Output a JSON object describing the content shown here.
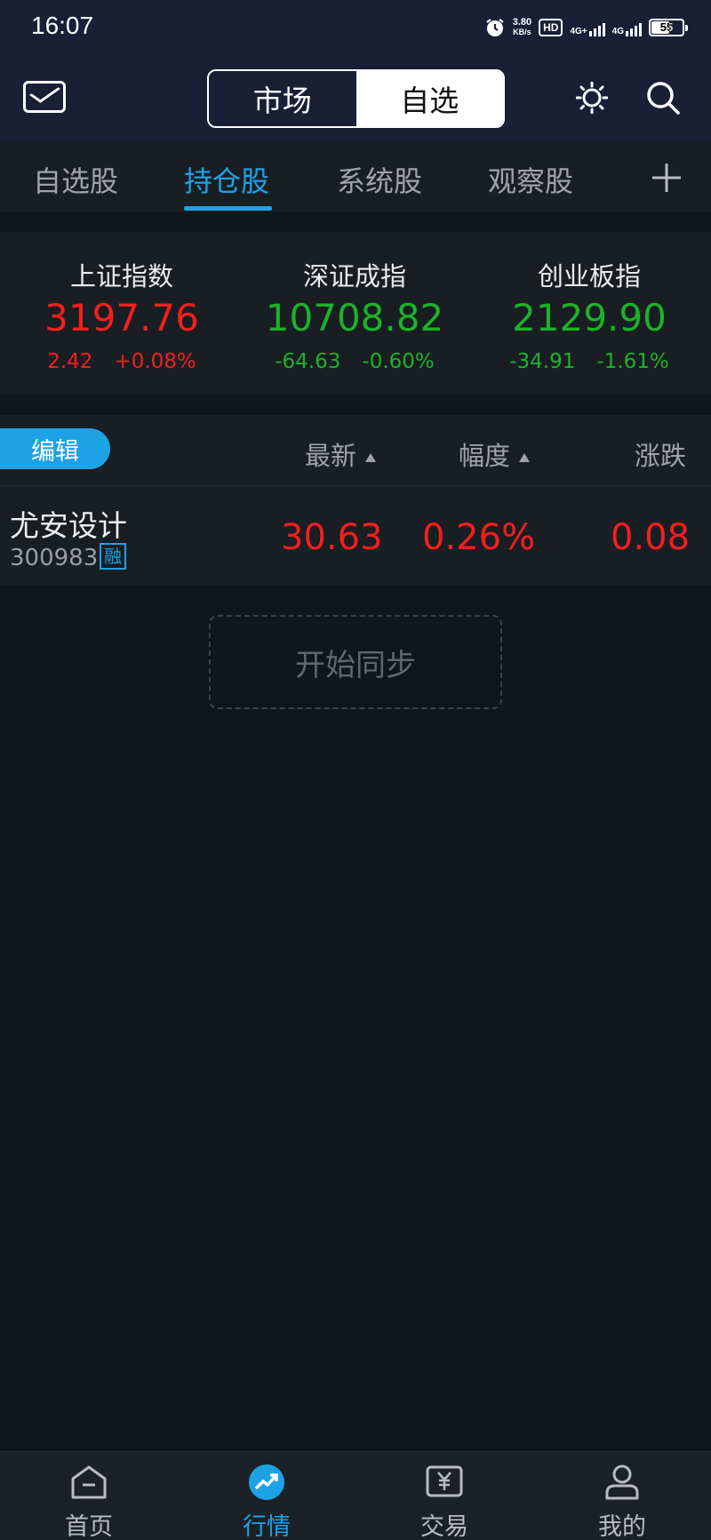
{
  "status_bar": {
    "time": "16:07",
    "net_speed_value": "3.80",
    "net_speed_unit": "KB/s",
    "hd_label": "HD",
    "network1": "4G+",
    "network2": "4G",
    "battery": "55"
  },
  "header": {
    "segments": [
      "市场",
      "自选"
    ],
    "active_segment": "自选"
  },
  "tabs": {
    "items": [
      "自选股",
      "持仓股",
      "系统股",
      "观察股"
    ],
    "active": "持仓股",
    "add_label": "+"
  },
  "indices": [
    {
      "name": "上证指数",
      "value": "3197.76",
      "change": "2.42",
      "pct": "+0.08%",
      "color": "#f51e1e"
    },
    {
      "name": "深证成指",
      "value": "10708.82",
      "change": "-64.63",
      "pct": "-0.60%",
      "color": "#1cb22a"
    },
    {
      "name": "创业板指",
      "value": "2129.90",
      "change": "-34.91",
      "pct": "-1.61%",
      "color": "#1cb22a"
    }
  ],
  "list_header": {
    "edit_label": "编辑",
    "columns": [
      "最新",
      "幅度",
      "涨跌"
    ]
  },
  "rows": [
    {
      "name": "尤安设计",
      "code": "300983",
      "badge": "融",
      "latest": "30.63",
      "pct": "0.26%",
      "change": "0.08",
      "color": "#f51e1e"
    }
  ],
  "sync_label": "开始同步",
  "bottom_nav": {
    "items": [
      {
        "label": "首页",
        "icon": "home-icon"
      },
      {
        "label": "行情",
        "icon": "market-trend-icon"
      },
      {
        "label": "交易",
        "icon": "trade-yen-icon"
      },
      {
        "label": "我的",
        "icon": "user-icon"
      }
    ],
    "active": "行情"
  },
  "colors": {
    "accent": "#1ea2e6",
    "up": "#f51e1e",
    "down": "#1cb22a",
    "header_bg": "#1a1f36",
    "panel_bg": "#181e22",
    "page_bg": "#10161b"
  }
}
